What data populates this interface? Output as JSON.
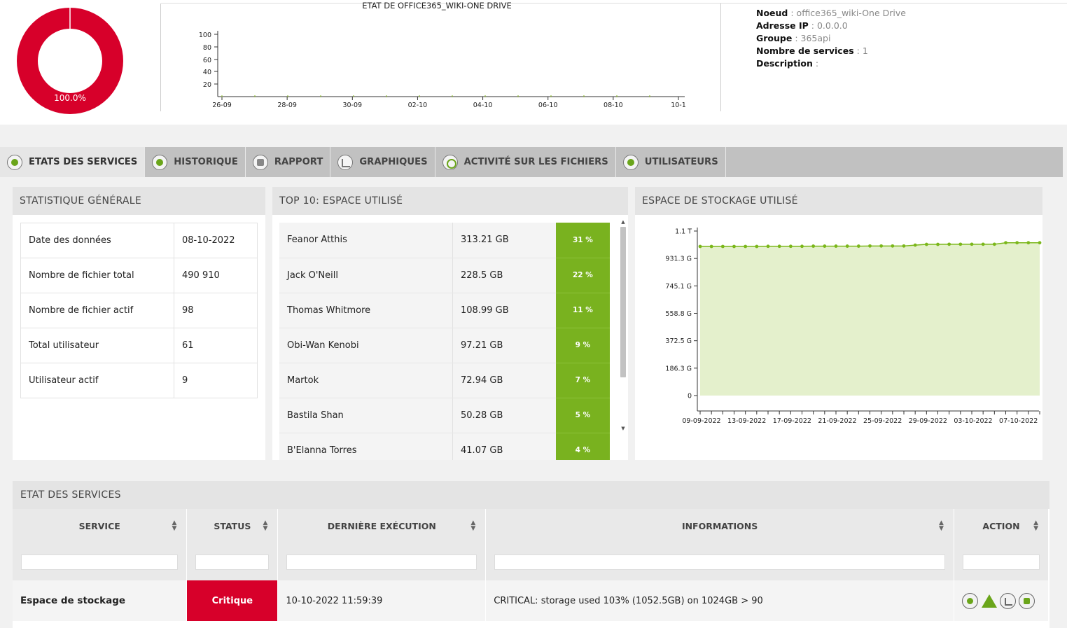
{
  "donut": {
    "label": "100.0%",
    "percent": 100,
    "color": "#d7002a"
  },
  "top_chart": {
    "title": "ETAT DE OFFICE365_WIKI-ONE DRIVE",
    "y_ticks": [
      "100",
      "80",
      "60",
      "40",
      "20"
    ],
    "x_ticks": [
      "26-09",
      "28-09",
      "30-09",
      "02-10",
      "04-10",
      "06-10",
      "08-10",
      "10-1"
    ]
  },
  "node_info": [
    {
      "key": "Noeud",
      "value": "office365_wiki-One Drive"
    },
    {
      "key": "Adresse IP",
      "value": "0.0.0.0"
    },
    {
      "key": "Groupe",
      "value": "365api"
    },
    {
      "key": "Nombre de services",
      "value": "1"
    },
    {
      "key": "Description",
      "value": ""
    }
  ],
  "tabs": [
    {
      "label": "ETATS DES SERVICES",
      "icon": "heartbeat-icon",
      "active": true
    },
    {
      "label": "HISTORIQUE",
      "icon": "clock-icon",
      "active": false
    },
    {
      "label": "RAPPORT",
      "icon": "report-icon",
      "active": false
    },
    {
      "label": "GRAPHIQUES",
      "icon": "chart-icon",
      "active": false
    },
    {
      "label": "ACTIVITÉ SUR LES FICHIERS",
      "icon": "file-search-icon",
      "active": false
    },
    {
      "label": "UTILISATEURS",
      "icon": "users-icon",
      "active": false
    }
  ],
  "stats": {
    "title": "STATISTIQUE GÉNÉRALE",
    "rows": [
      {
        "label": "Date des données",
        "value": "08-10-2022"
      },
      {
        "label": "Nombre de fichier total",
        "value": "490 910"
      },
      {
        "label": "Nombre de fichier actif",
        "value": "98"
      },
      {
        "label": "Total utilisateur",
        "value": "61"
      },
      {
        "label": "Utilisateur actif",
        "value": "9"
      }
    ]
  },
  "top10": {
    "title": "TOP 10: ESPACE UTILISÉ",
    "rows": [
      {
        "name": "Feanor Atthis",
        "size": "313.21 GB",
        "pct": "31 %"
      },
      {
        "name": "Jack O'Neill",
        "size": "228.5 GB",
        "pct": "22 %"
      },
      {
        "name": "Thomas Whitmore",
        "size": "108.99 GB",
        "pct": "11 %"
      },
      {
        "name": "Obi-Wan Kenobi",
        "size": "97.21 GB",
        "pct": "9 %"
      },
      {
        "name": "Martok",
        "size": "72.94 GB",
        "pct": "7 %"
      },
      {
        "name": "Bastila Shan",
        "size": "50.28 GB",
        "pct": "5 %"
      },
      {
        "name": "B'Elanna Torres",
        "size": "41.07 GB",
        "pct": "4 %"
      }
    ]
  },
  "storage": {
    "title": "ESPACE DE STOCKAGE UTILISÉ"
  },
  "chart_data": {
    "type": "area",
    "title": "",
    "y_tick_labels": [
      "0",
      "186.3 G",
      "372.5 G",
      "558.8 G",
      "745.1 G",
      "931.3 G",
      "1.1 T"
    ],
    "y_tick_values": [
      0,
      186.3,
      372.5,
      558.8,
      745.1,
      931.3,
      1117.6
    ],
    "ylim": [
      0,
      1117.6
    ],
    "x_tick_labels": [
      "09-09-2022",
      "13-09-2022",
      "17-09-2022",
      "21-09-2022",
      "25-09-2022",
      "29-09-2022",
      "03-10-2022",
      "07-10-2022"
    ],
    "x": [
      "09-09-2022",
      "10-09-2022",
      "11-09-2022",
      "12-09-2022",
      "13-09-2022",
      "14-09-2022",
      "15-09-2022",
      "16-09-2022",
      "17-09-2022",
      "18-09-2022",
      "19-09-2022",
      "20-09-2022",
      "21-09-2022",
      "22-09-2022",
      "23-09-2022",
      "24-09-2022",
      "25-09-2022",
      "26-09-2022",
      "27-09-2022",
      "28-09-2022",
      "29-09-2022",
      "30-09-2022",
      "01-10-2022",
      "02-10-2022",
      "03-10-2022",
      "04-10-2022",
      "05-10-2022",
      "06-10-2022",
      "07-10-2022",
      "08-10-2022",
      "09-10-2022"
    ],
    "values": [
      1013,
      1013,
      1013,
      1013,
      1013,
      1013,
      1014,
      1014,
      1014,
      1014,
      1015,
      1015,
      1015,
      1015,
      1015,
      1016,
      1016,
      1016,
      1016,
      1022,
      1027,
      1027,
      1028,
      1028,
      1028,
      1028,
      1028,
      1038,
      1038,
      1038,
      1038
    ],
    "grid": false,
    "fill_color": "#e4f0cc",
    "line_color": "#7bb71b"
  },
  "services": {
    "title": "ETAT DES SERVICES",
    "columns": [
      "SERVICE",
      "STATUS",
      "DERNIÈRE EXÉCUTION",
      "INFORMATIONS",
      "ACTION"
    ],
    "rows": [
      {
        "service": "Espace de stockage",
        "status": "Critique",
        "status_color": "#d7002a",
        "last_exec": "10-10-2022 11:59:39",
        "info": "CRITICAL: storage used 103% (1052.5GB) on 1024GB > 90",
        "actions": [
          "settings-icon",
          "acknowledge-icon",
          "graph-icon",
          "schedule-icon"
        ]
      }
    ]
  }
}
